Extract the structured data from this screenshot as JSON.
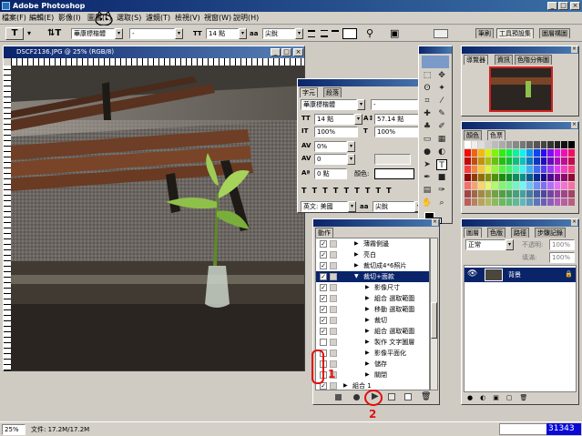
{
  "title": "Adobe Photoshop",
  "menu": [
    "檔案(F)",
    "編輯(E)",
    "影像(I)",
    "圖層(L)",
    "選取(S)",
    "濾鏡(T)",
    "檢視(V)",
    "視窗(W)",
    "說明(H)"
  ],
  "options": {
    "font_family": "華康標楷體",
    "font_style": "-",
    "size_icon": "TT",
    "size": "14 點",
    "antialias": "尖銳"
  },
  "panel_tabs": [
    "筆刷",
    "工具預設集",
    "圖層構圖"
  ],
  "doc": {
    "title": "DSCF2136.JPG @ 25% (RGB/8)"
  },
  "char_panel": {
    "tabs": [
      "字元",
      "段落"
    ],
    "font": "華康標楷體",
    "style": "-",
    "size": "14 點",
    "leading": "57.14 點",
    "vscale": "100%",
    "hscale": "100%",
    "tracking": "0%",
    "kerning": "0",
    "baseline": "0 點",
    "color_label": "顏色:",
    "lang": "英文: 美國",
    "aa": "尖銳"
  },
  "actions": {
    "tabs": [
      "動作"
    ],
    "rows": [
      {
        "label": "薄霧側邊",
        "level": 1,
        "checked": true,
        "expanded": false
      },
      {
        "label": "亮白",
        "level": 1,
        "checked": true,
        "expanded": false
      },
      {
        "label": "裁切成4*6照片",
        "level": 1,
        "checked": true,
        "expanded": false
      },
      {
        "label": "裁切+面款",
        "level": 1,
        "checked": true,
        "expanded": true,
        "selected": true
      },
      {
        "label": "影像尺寸",
        "level": 2,
        "checked": true,
        "expanded": false
      },
      {
        "label": "組合 選取範圍",
        "level": 2,
        "checked": true,
        "expanded": false
      },
      {
        "label": "移動 選取範圍",
        "level": 2,
        "checked": true,
        "expanded": false
      },
      {
        "label": "裁切",
        "level": 2,
        "checked": true,
        "expanded": false
      },
      {
        "label": "組合 選取範圍",
        "level": 2,
        "checked": true,
        "expanded": false
      },
      {
        "label": "製作 文字圖層",
        "level": 2,
        "checked": false,
        "expanded": false
      },
      {
        "label": "影像平面化",
        "level": 2,
        "checked": false,
        "expanded": false
      },
      {
        "label": "儲存",
        "level": 2,
        "checked": false,
        "expanded": false
      },
      {
        "label": "關閉",
        "level": 2,
        "checked": false,
        "expanded": false
      },
      {
        "label": "組合 1",
        "level": 0,
        "checked": true,
        "expanded": false
      }
    ]
  },
  "navigator": {
    "tabs": [
      "導覽器",
      "資訊",
      "色階分佈圖"
    ]
  },
  "color": {
    "tabs": [
      "顏色",
      "色票"
    ]
  },
  "layers": {
    "tabs": [
      "圖層",
      "色版",
      "路徑",
      "步驟記錄"
    ],
    "mode": "正常",
    "opacity_label": "不透明:",
    "opacity": "100%",
    "fill_label": "填滿:",
    "fill": "100%",
    "layer_name": "背景"
  },
  "annotations": {
    "one": "1",
    "two": "2"
  },
  "status": {
    "zoom": "25%",
    "doc_size": "文件: 17.2M/17.2M",
    "watermark": "31343"
  }
}
